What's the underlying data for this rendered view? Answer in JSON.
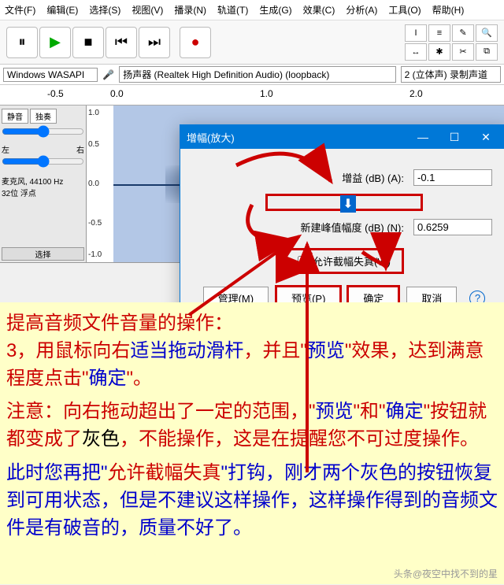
{
  "menu": [
    "文件(F)",
    "编辑(E)",
    "选择(S)",
    "视图(V)",
    "播录(N)",
    "轨道(T)",
    "生成(G)",
    "效果(C)",
    "分析(A)",
    "工具(O)",
    "帮助(H)"
  ],
  "ruler": {
    "t0": "0.0",
    "t1": "1.0",
    "t2": "2.0",
    "pre": "-0.5"
  },
  "device": {
    "host": "Windows WASAPI",
    "in": "扬声器 (Realtek High Definition Audio) (loopback)",
    "ch": "2 (立体声) 录制声道"
  },
  "track": {
    "mute": "静音",
    "solo": "独奏",
    "left": "左",
    "right": "右",
    "info": "麦克风, 44100 Hz\n32位 浮点",
    "sel": "选择"
  },
  "axis": {
    "p10": "1.0",
    "p05": "0.5",
    "z": "0.0",
    "n05": "-0.5",
    "n10": "-1.0"
  },
  "dialog": {
    "title": "增幅(放大)",
    "gain_label": "增益 (dB) (A):",
    "gain_val": "-0.1",
    "peak_label": "新建峰值幅度 (dB) (N):",
    "peak_val": "0.6259",
    "clip": "允许截幅失真(W)",
    "manage": "管理(M)",
    "preview": "预览(P)",
    "ok": "确定",
    "cancel": "取消"
  },
  "tut": {
    "l1": "提高音频文件音量的操作：",
    "l2a": "3，用鼠标向右",
    "l2b": "适当拖动滑杆",
    "l2c": "，并且\"",
    "l2d": "预览",
    "l2e": "\"效果，达到满意程度点击\"",
    "l2f": "确定",
    "l2g": "\"。",
    "l3a": "注意：向右拖动超出了一定的范围，\"",
    "l3b": "预览",
    "l3c": "\"和\"",
    "l3d": "确定",
    "l3e": "\"按钮就都变成了",
    "l3f": "灰色",
    "l3g": "，不能操作，这是在提醒您不可过度操作。",
    "l4a": "此时您再把\"",
    "l4b": "允许截幅失真",
    "l4c": "\"打钩，刚才两个灰色的按钮恢复到可用状态，但是不建议这样操作，这样操作得到的音频文件是有破音的，质量不好了。"
  },
  "watermark": "头条@夜空中找不到的星"
}
